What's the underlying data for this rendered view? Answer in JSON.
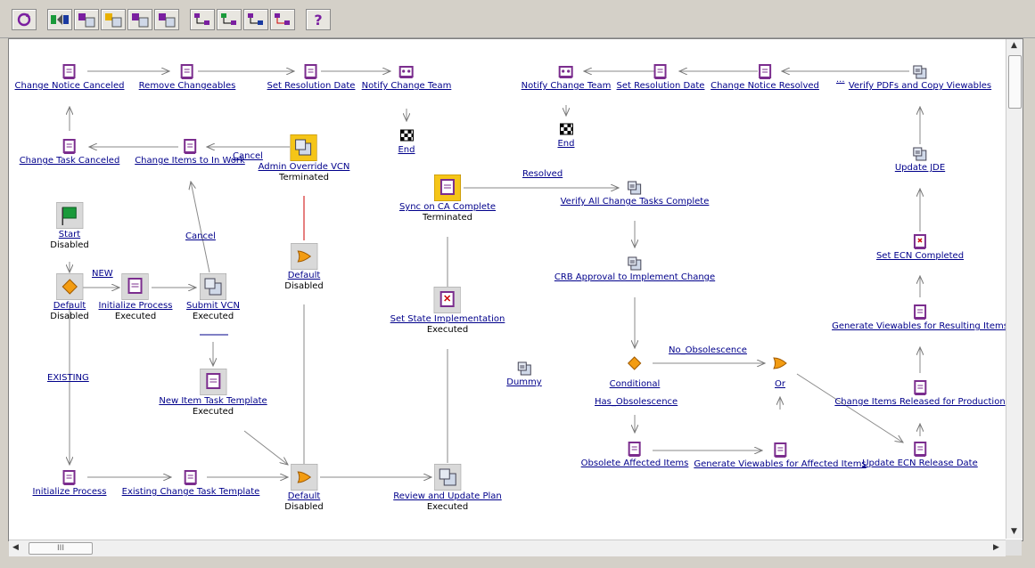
{
  "toolbar": {
    "buttons": [
      {
        "name": "refresh-button",
        "icon": "refresh-icon"
      },
      {
        "name": "tool-2-button",
        "icon": "flow-icon"
      },
      {
        "name": "tool-3-button",
        "icon": "activity-icon"
      },
      {
        "name": "tool-4-button",
        "icon": "activity-icon"
      },
      {
        "name": "tool-5-button",
        "icon": "activity-icon"
      },
      {
        "name": "tool-6-button",
        "icon": "activity-icon"
      },
      {
        "name": "tool-7-button",
        "icon": "tree-icon"
      },
      {
        "name": "tool-8-button",
        "icon": "tree-icon"
      },
      {
        "name": "tool-9-button",
        "icon": "tree-icon"
      },
      {
        "name": "tool-10-button",
        "icon": "tree-icon"
      },
      {
        "name": "help-button",
        "icon": "help-icon",
        "label": "?"
      }
    ]
  },
  "nodes": {
    "change_notice_canceled": {
      "label": "Change Notice Canceled"
    },
    "remove_changeables": {
      "label": "Remove Changeables"
    },
    "set_resolution_date_left": {
      "label": "Set Resolution Date"
    },
    "notify_change_team_left": {
      "label": "Notify Change Team"
    },
    "end_left": {
      "label": "End"
    },
    "notify_change_team_right": {
      "label": "Notify Change Team"
    },
    "set_resolution_date_right": {
      "label": "Set Resolution Date"
    },
    "change_notice_resolved": {
      "label": "Change Notice Resolved"
    },
    "ellipsis": {
      "label": "..."
    },
    "verify_pdfs": {
      "label": "Verify PDFs and Copy Viewables"
    },
    "end_right": {
      "label": "End"
    },
    "change_task_canceled": {
      "label": "Change Task Canceled"
    },
    "change_items_to_in_work": {
      "label": "Change Items to In Work"
    },
    "admin_override_vcn": {
      "label": "Admin Override VCN",
      "status": "Terminated"
    },
    "sync_on_ca_complete": {
      "label": "Sync on CA Complete",
      "status": "Terminated"
    },
    "verify_all_change_tasks": {
      "label": "Verify All Change Tasks Complete"
    },
    "update_jde": {
      "label": "Update JDE"
    },
    "start": {
      "label": "Start",
      "status": "Disabled"
    },
    "default_top": {
      "label": "Default",
      "status": "Disabled"
    },
    "crb_approval": {
      "label": "CRB Approval to Implement Change"
    },
    "set_ecn_completed": {
      "label": "Set ECN Completed"
    },
    "default_left": {
      "label": "Default",
      "status": "Disabled"
    },
    "initialize_process_top": {
      "label": "Initialize Process",
      "status": "Executed"
    },
    "submit_vcn": {
      "label": "Submit VCN",
      "status": "Executed"
    },
    "set_state_implementation": {
      "label": "Set State Implementation",
      "status": "Executed"
    },
    "generate_viewables_resulting": {
      "label": "Generate Viewables for Resulting Items"
    },
    "dummy": {
      "label": "Dummy"
    },
    "conditional": {
      "label": "Conditional"
    },
    "or": {
      "label": "Or"
    },
    "new_item_task_template": {
      "label": "New Item Task Template",
      "status": "Executed"
    },
    "change_items_released": {
      "label": "Change Items Released for Production"
    },
    "initialize_process_bottom": {
      "label": "Initialize Process"
    },
    "existing_change_task_template": {
      "label": "Existing Change Task Template"
    },
    "default_bottom": {
      "label": "Default",
      "status": "Disabled"
    },
    "review_and_update_plan": {
      "label": "Review and Update Plan",
      "status": "Executed"
    },
    "obsolete_affected_items": {
      "label": "Obsolete Affected Items"
    },
    "generate_viewables_affected": {
      "label": "Generate Viewables for Affected Items"
    },
    "update_ecn_release_date": {
      "label": "Update ECN Release Date"
    }
  },
  "edge_labels": {
    "cancel_top": "Cancel",
    "cancel_mid": "Cancel",
    "new": "NEW",
    "existing": "EXISTING",
    "resolved": "Resolved",
    "no_obsolescence": "No_Obsolescence",
    "has_obsolescence": "Has_Obsolescence"
  },
  "scrollbar": {
    "h_thumb_grip": "III"
  },
  "colors": {
    "link": "#00008b",
    "accent_yellow": "#f5c518",
    "gateway_orange": "#f39c12",
    "task_purple": "#7b2d8e"
  }
}
